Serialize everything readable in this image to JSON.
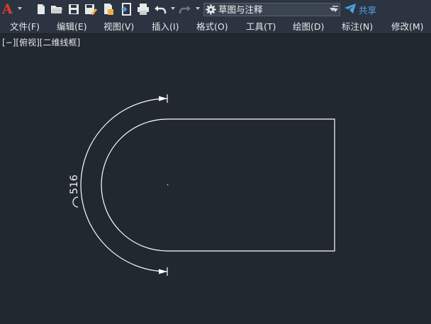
{
  "app": {
    "logo_letter": "A",
    "brand_color": "#e23b2e"
  },
  "toolbar": {
    "icons": [
      "new-icon",
      "open-icon",
      "save-icon",
      "save-as-icon",
      "publish-icon",
      "export-icon",
      "print-icon",
      "undo-icon",
      "redo-icon"
    ],
    "workspace_label": "草图与注释",
    "share_label": "共享",
    "accent_color": "#4ea3ea"
  },
  "menu": {
    "items": [
      "文件(F)",
      "编辑(E)",
      "视图(V)",
      "插入(I)",
      "格式(O)",
      "工具(T)",
      "绘图(D)",
      "标注(N)",
      "修改(M)"
    ]
  },
  "viewport": {
    "label": "[−][俯视][二维线框]"
  },
  "drawing": {
    "dimension_text": "516",
    "background": "#212830",
    "line_color": "#ffffff"
  }
}
